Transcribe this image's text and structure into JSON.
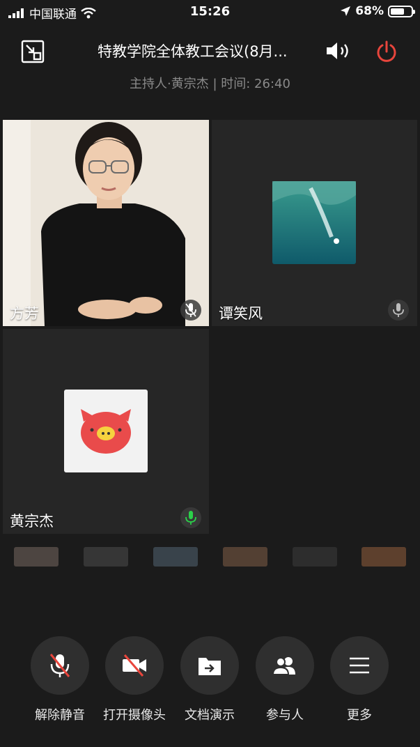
{
  "status_bar": {
    "carrier": "中国联通",
    "time": "15:26",
    "battery": "68%",
    "battery_level": 0.68
  },
  "header": {
    "title": "特教学院全体教工会议(8月...",
    "subtitle": "主持人·黄宗杰 | 时间: 26:40"
  },
  "participants": [
    {
      "name": "方芳",
      "mic": "muted"
    },
    {
      "name": "谭笑风",
      "mic": "muted"
    },
    {
      "name": "黄宗杰",
      "mic": "active"
    }
  ],
  "toolbar": [
    {
      "label": "解除静音",
      "icon": "mic-off-icon"
    },
    {
      "label": "打开摄像头",
      "icon": "camera-off-icon"
    },
    {
      "label": "文档演示",
      "icon": "document-share-icon"
    },
    {
      "label": "参与人",
      "icon": "participants-icon"
    },
    {
      "label": "更多",
      "icon": "menu-icon"
    }
  ],
  "colors": {
    "background": "#1b1b1b",
    "tile": "#262626",
    "power_red": "#e8453c",
    "mic_active": "#2bd04a"
  }
}
